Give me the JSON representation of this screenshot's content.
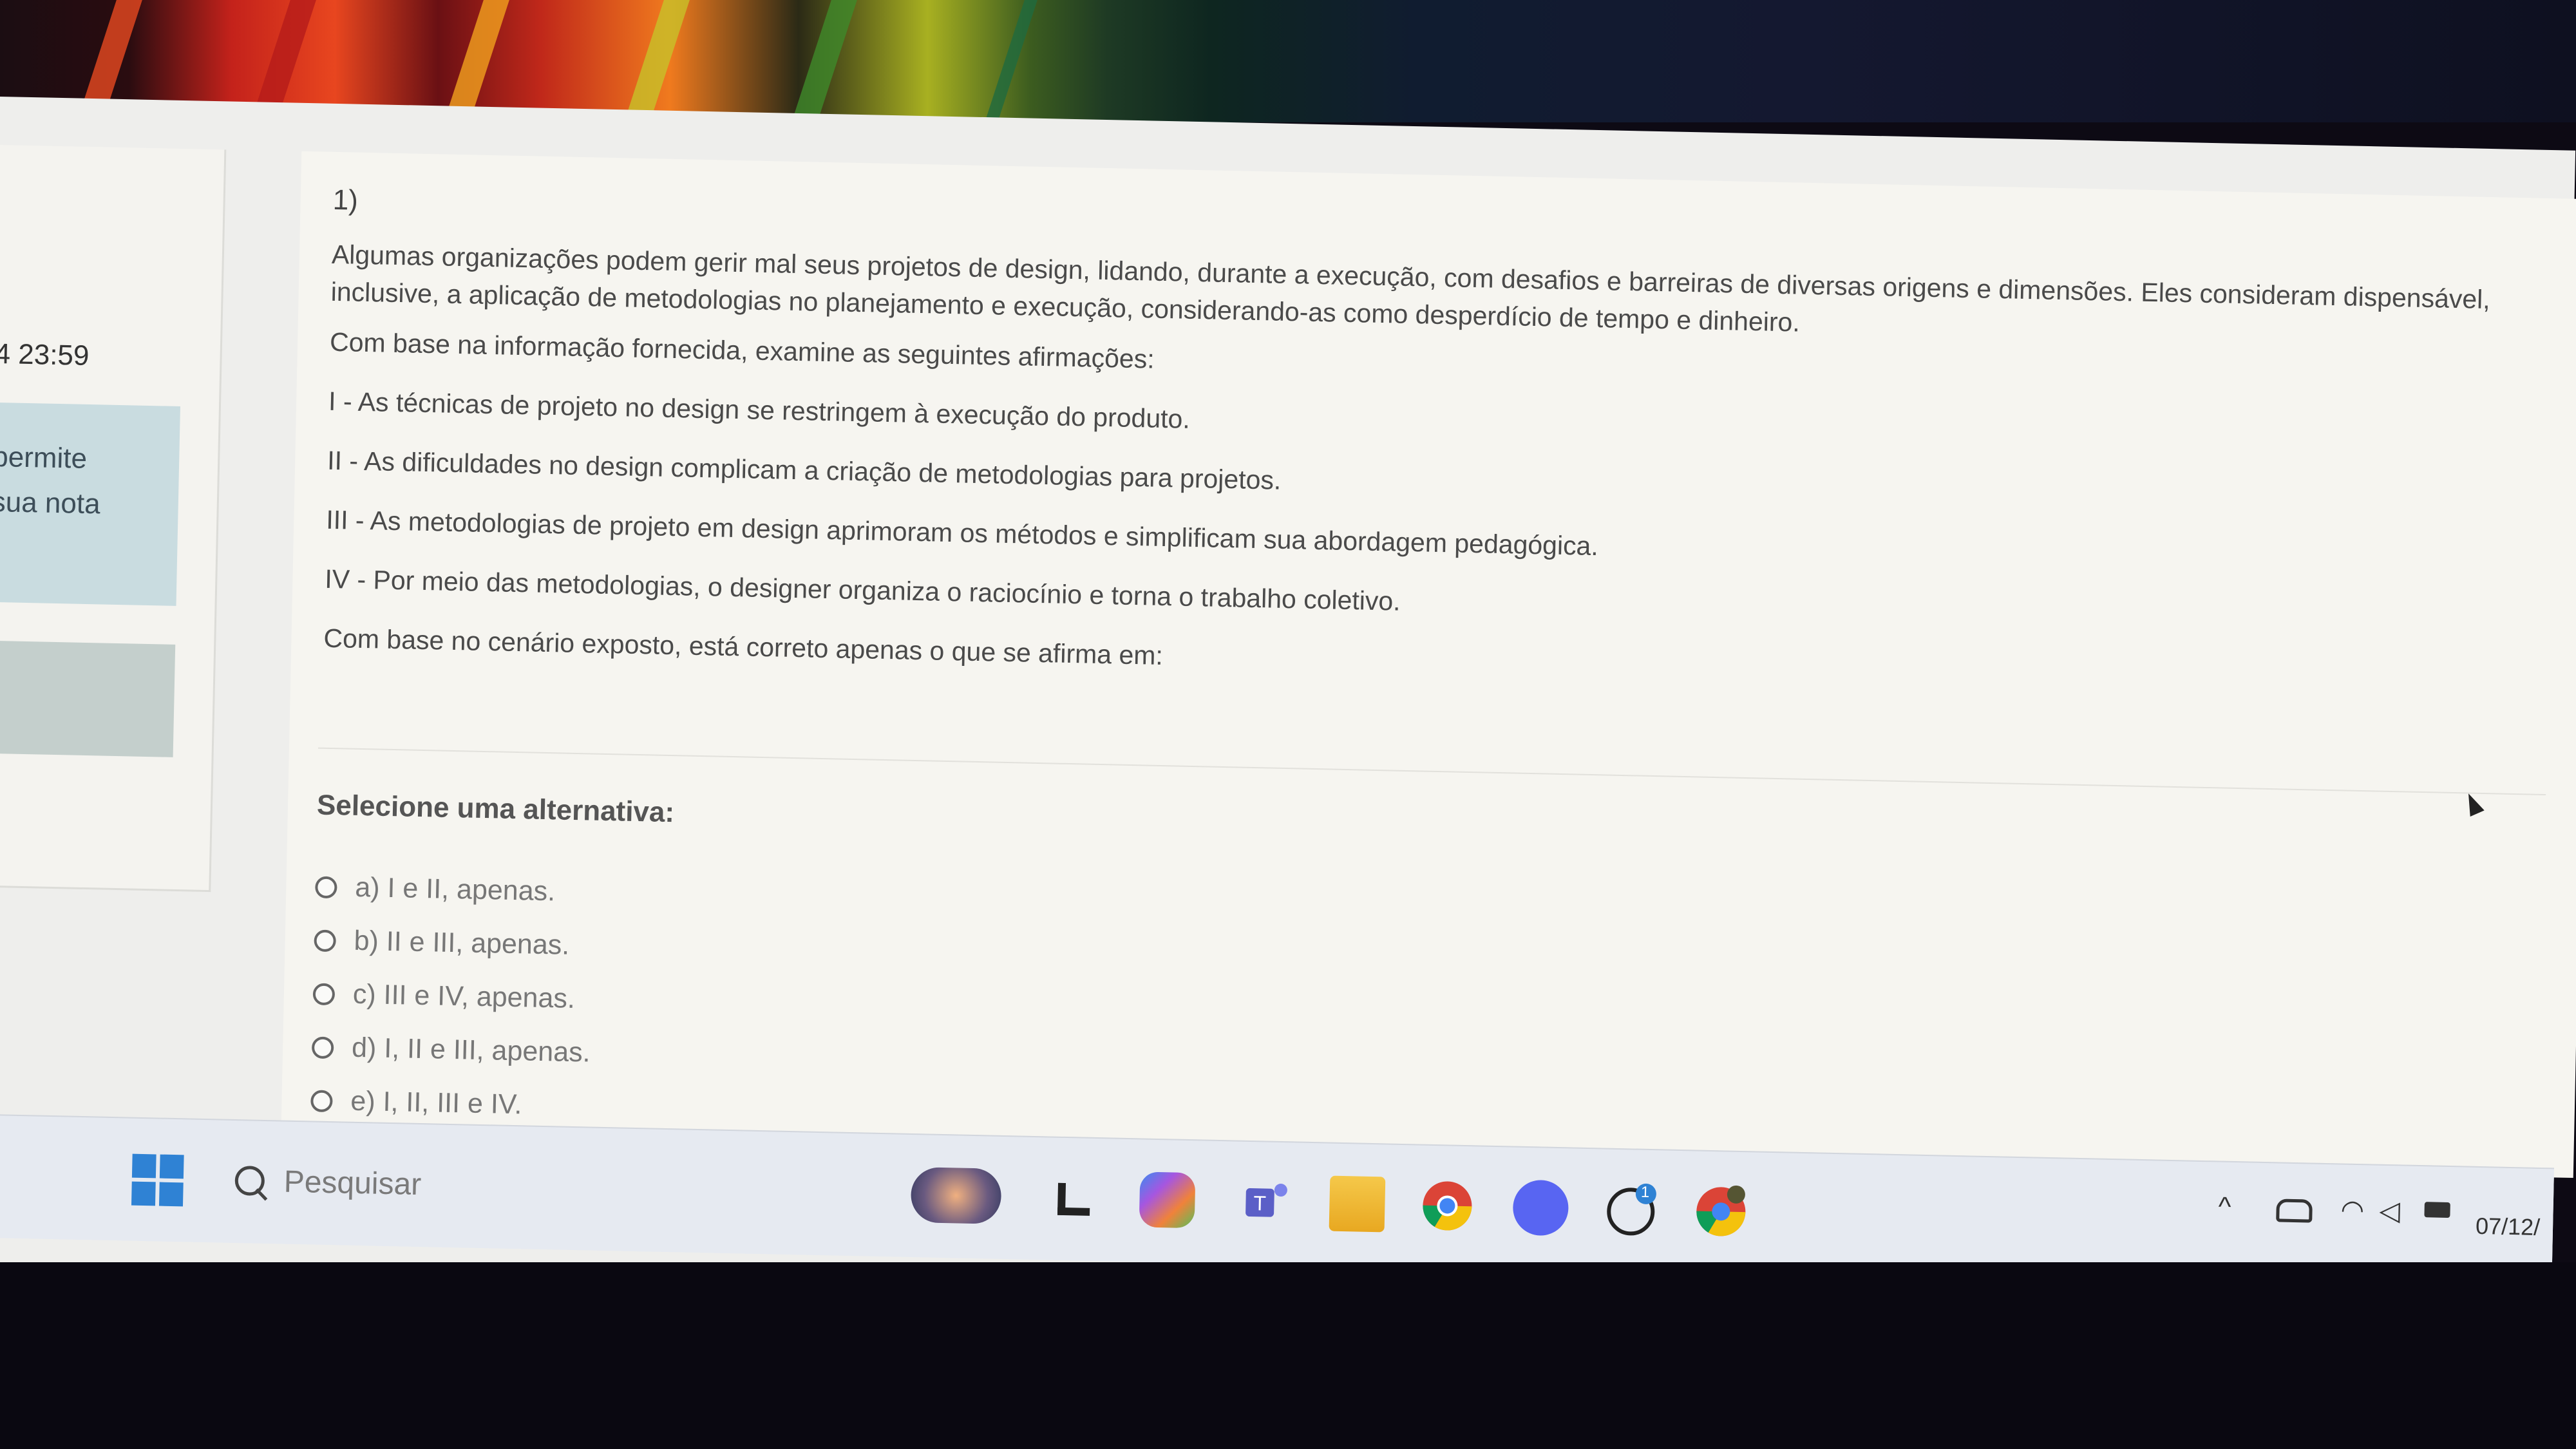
{
  "left_panel": {
    "timer": "4 23:59",
    "info_lines": [
      "permite",
      "sua nota"
    ]
  },
  "question": {
    "number": "1)",
    "paragraphs": [
      "Algumas organizações podem gerir mal seus projetos de design, lidando, durante a execução, com desafios e barreiras de diversas origens e dimensões. Eles consideram dispensável, inclusive, a aplicação de metodologias no planejamento e execução, considerando-as como desperdício de tempo e dinheiro.",
      "Com base na informação fornecida, examine as seguintes afirmações:",
      "I - As técnicas de projeto no design se restringem à execução do produto.",
      "II - As dificuldades no design complicam a criação de metodologias para projetos.",
      "III - As metodologias de projeto em design aprimoram os métodos e simplificam sua abordagem pedagógica.",
      "IV - Por meio das metodologias, o designer organiza o raciocínio e torna o trabalho coletivo.",
      "Com base no cenário exposto, está correto apenas o que se afirma em:"
    ],
    "select_label": "Selecione uma alternativa:",
    "options": [
      "a) I e II, apenas.",
      "b) II e III, apenas.",
      "c) III e IV, apenas.",
      "d) I, II e III, apenas.",
      "e) I, II, III e IV."
    ]
  },
  "taskbar": {
    "search_placeholder": "Pesquisar",
    "icons": [
      "windows-start-icon",
      "search-icon",
      "widget-icon",
      "task-view-icon",
      "copilot-icon",
      "teams-icon",
      "file-explorer-icon",
      "chrome-icon",
      "discord-icon",
      "whatsapp-icon",
      "chrome-profile-icon"
    ],
    "whatsapp_badge": "1",
    "tray": {
      "chevron": "^",
      "date": "07/12/"
    }
  },
  "colors": {
    "accent_blue": "#2f82d4",
    "info_box": "#c9dce0",
    "page_bg": "#f6f5f0"
  }
}
